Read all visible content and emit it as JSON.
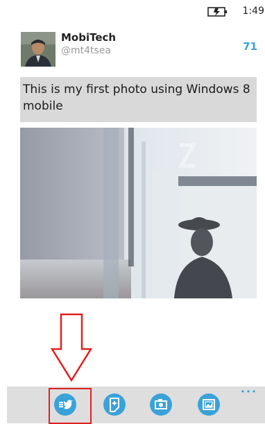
{
  "status_bar": {
    "time": "1:49",
    "battery_icon": "battery-charging-icon"
  },
  "account": {
    "name": "MobiTech",
    "handle": "@mt4tsea"
  },
  "compose": {
    "remaining_chars": "71",
    "text": "This is my first photo using Windows 8 mobile"
  },
  "attachment": {
    "icon": "photo-thumbnail"
  },
  "app_bar": {
    "buttons": [
      {
        "name": "tweet-send-button",
        "icon": "twitter-bird-icon"
      },
      {
        "name": "add-note-button",
        "icon": "note-plus-icon"
      },
      {
        "name": "camera-button",
        "icon": "camera-icon"
      },
      {
        "name": "gallery-button",
        "icon": "picture-icon"
      }
    ],
    "more_icon": "more-dots-icon"
  },
  "colors": {
    "accent": "#3aa2d8",
    "tweet_box_bg": "#d9d9d9",
    "app_bar_bg": "#dedede",
    "annotation": "#e02020"
  }
}
